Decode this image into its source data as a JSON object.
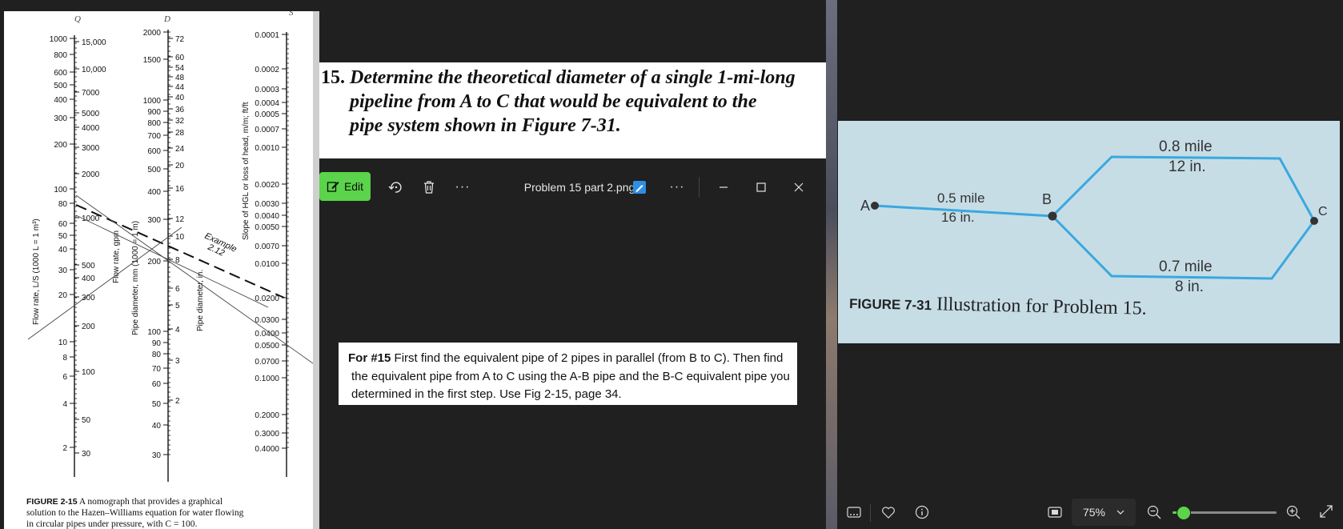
{
  "nomograph": {
    "headers": {
      "q": "Q",
      "d": "D",
      "s": "S"
    },
    "q_left_ticks": [
      "1000",
      "800",
      "600",
      "500",
      "400",
      "300",
      "200",
      "100",
      "80",
      "60",
      "50",
      "40",
      "30",
      "20",
      "10",
      "8",
      "6",
      "4",
      "2"
    ],
    "q_right_ticks": [
      "15,000",
      "10,000",
      "7000",
      "5000",
      "4000",
      "3000",
      "2000",
      "1000",
      "500",
      "400",
      "300",
      "200",
      "100",
      "50",
      "30"
    ],
    "d_left_ticks": [
      "2000",
      "1500",
      "1000",
      "900",
      "800",
      "700",
      "600",
      "500",
      "400",
      "300",
      "200",
      "100",
      "90",
      "80",
      "70",
      "60",
      "50",
      "40",
      "30"
    ],
    "d_right_ticks": [
      "72",
      "60",
      "54",
      "48",
      "44",
      "40",
      "36",
      "32",
      "28",
      "24",
      "20",
      "16",
      "12",
      "10",
      "8",
      "6",
      "5",
      "4",
      "3",
      "2"
    ],
    "s_ticks": [
      "0.0001",
      "0.0002",
      "0.0003",
      "0.0004",
      "0.0005",
      "0.0007",
      "0.0010",
      "0.0020",
      "0.0030",
      "0.0040",
      "0.0050",
      "0.0070",
      "0.0100",
      "0.0200",
      "0.0300",
      "0.0400",
      "0.0500",
      "0.0700",
      "0.1000",
      "0.2000",
      "0.3000",
      "0.4000"
    ],
    "axis_q_si": "Flow rate, L/S  (1000 L = 1 m³)",
    "axis_q_us": "Flow rate, gpm",
    "axis_d_si": "Pipe diameter, mm  (1000 = 1 m)",
    "axis_d_us": "Pipe diameter, in.",
    "axis_s": "Slope of HGL or loss of head, m/m; ft/ft",
    "example": "Example",
    "example_num": "2.12",
    "caption_label": "FIGURE 2-15",
    "caption_line1": " A nomograph that provides a graphical",
    "caption_line2": "solution to the Hazen–Williams equation for water flowing",
    "caption_line3": "in circular pipes under pressure, with C = 100."
  },
  "problem": {
    "number": "15.",
    "line1": "Determine the theoretical diameter of a single 1-mi-long",
    "line2": "pipeline from A to C that would be equivalent to the",
    "line3": "pipe system shown in Figure 7-31."
  },
  "toolbar": {
    "edit_label": "Edit",
    "file_name": "Problem 15 part 2.png",
    "more_label": "···"
  },
  "note": {
    "bold_lead": "For #15",
    "line1_rest": " First find the equivalent pipe of 2 pipes in parallel (from B to C).  Then find",
    "line2": "the equivalent pipe from A to C using the A-B pipe and the B-C equivalent pipe you",
    "line3": "determined in the first step. Use  Fig 2-15, page 34."
  },
  "figure": {
    "node_a": "A",
    "node_b": "B",
    "node_c": "C",
    "ab_length": "0.5 mile",
    "ab_diam": "16 in.",
    "top_length": "0.8 mile",
    "top_diam": "12 in.",
    "bottom_length": "0.7 mile",
    "bottom_diam": "8 in.",
    "caption_label": "FIGURE 7-31",
    "caption_text": " Illustration for Problem 15."
  },
  "viewer": {
    "zoom": "75%",
    "zoom_slider_fraction": 0.1
  },
  "colors": {
    "edit_green": "#5bd34a",
    "pipe_blue": "#3aa8de",
    "figure_bg": "#c6dde6",
    "dark_bg": "#202020"
  }
}
